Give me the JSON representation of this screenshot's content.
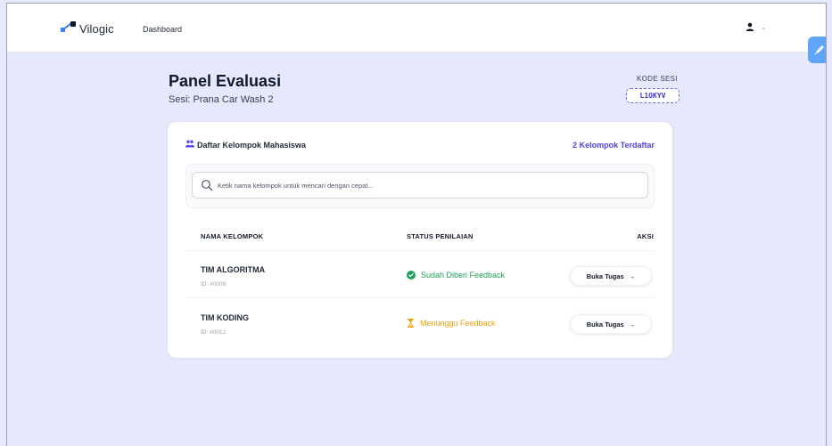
{
  "app": {
    "logo_text": "Vilogic",
    "nav_dashboard": "Dashboard",
    "user_icon": "user-icon",
    "dropdown_icon": "chevron-down-icon",
    "dropdown_glyph": "⌄"
  },
  "header": {
    "title": "Panel Evaluasi",
    "subtitle": "Sesi: Prana Car Wash 2",
    "session_code_label": "KODE SESI",
    "session_code": "L1OKYV"
  },
  "card": {
    "title": "Daftar Kelompok Mahasiswa",
    "group_count": "2 Kelompok Terdaftar",
    "search_placeholder": "Ketik nama kelompok untuk mencari dengan cepat...",
    "columns": {
      "name": "NAMA KELOMPOK",
      "status": "STATUS PENILAIAN",
      "action": "AKSI"
    },
    "rows": [
      {
        "name": "TIM ALGORITMA",
        "id": "ID: #0009",
        "status": "Sudah Diberi Feedback",
        "status_type": "done",
        "status_icon": "check-circle-icon",
        "action": "Buka Tugas",
        "action_arrow": "→"
      },
      {
        "name": "TIM KODING",
        "id": "ID: #0012",
        "status": "Menunggu Feedback",
        "status_type": "waiting",
        "status_icon": "hourglass-icon",
        "action": "Buka Tugas",
        "action_arrow": "→"
      }
    ]
  },
  "colors": {
    "background": "#e6e9fb",
    "accent": "#4f46e5",
    "success": "#22a05a",
    "warning": "#f59e0b",
    "logo_blue": "#3b82f6"
  }
}
